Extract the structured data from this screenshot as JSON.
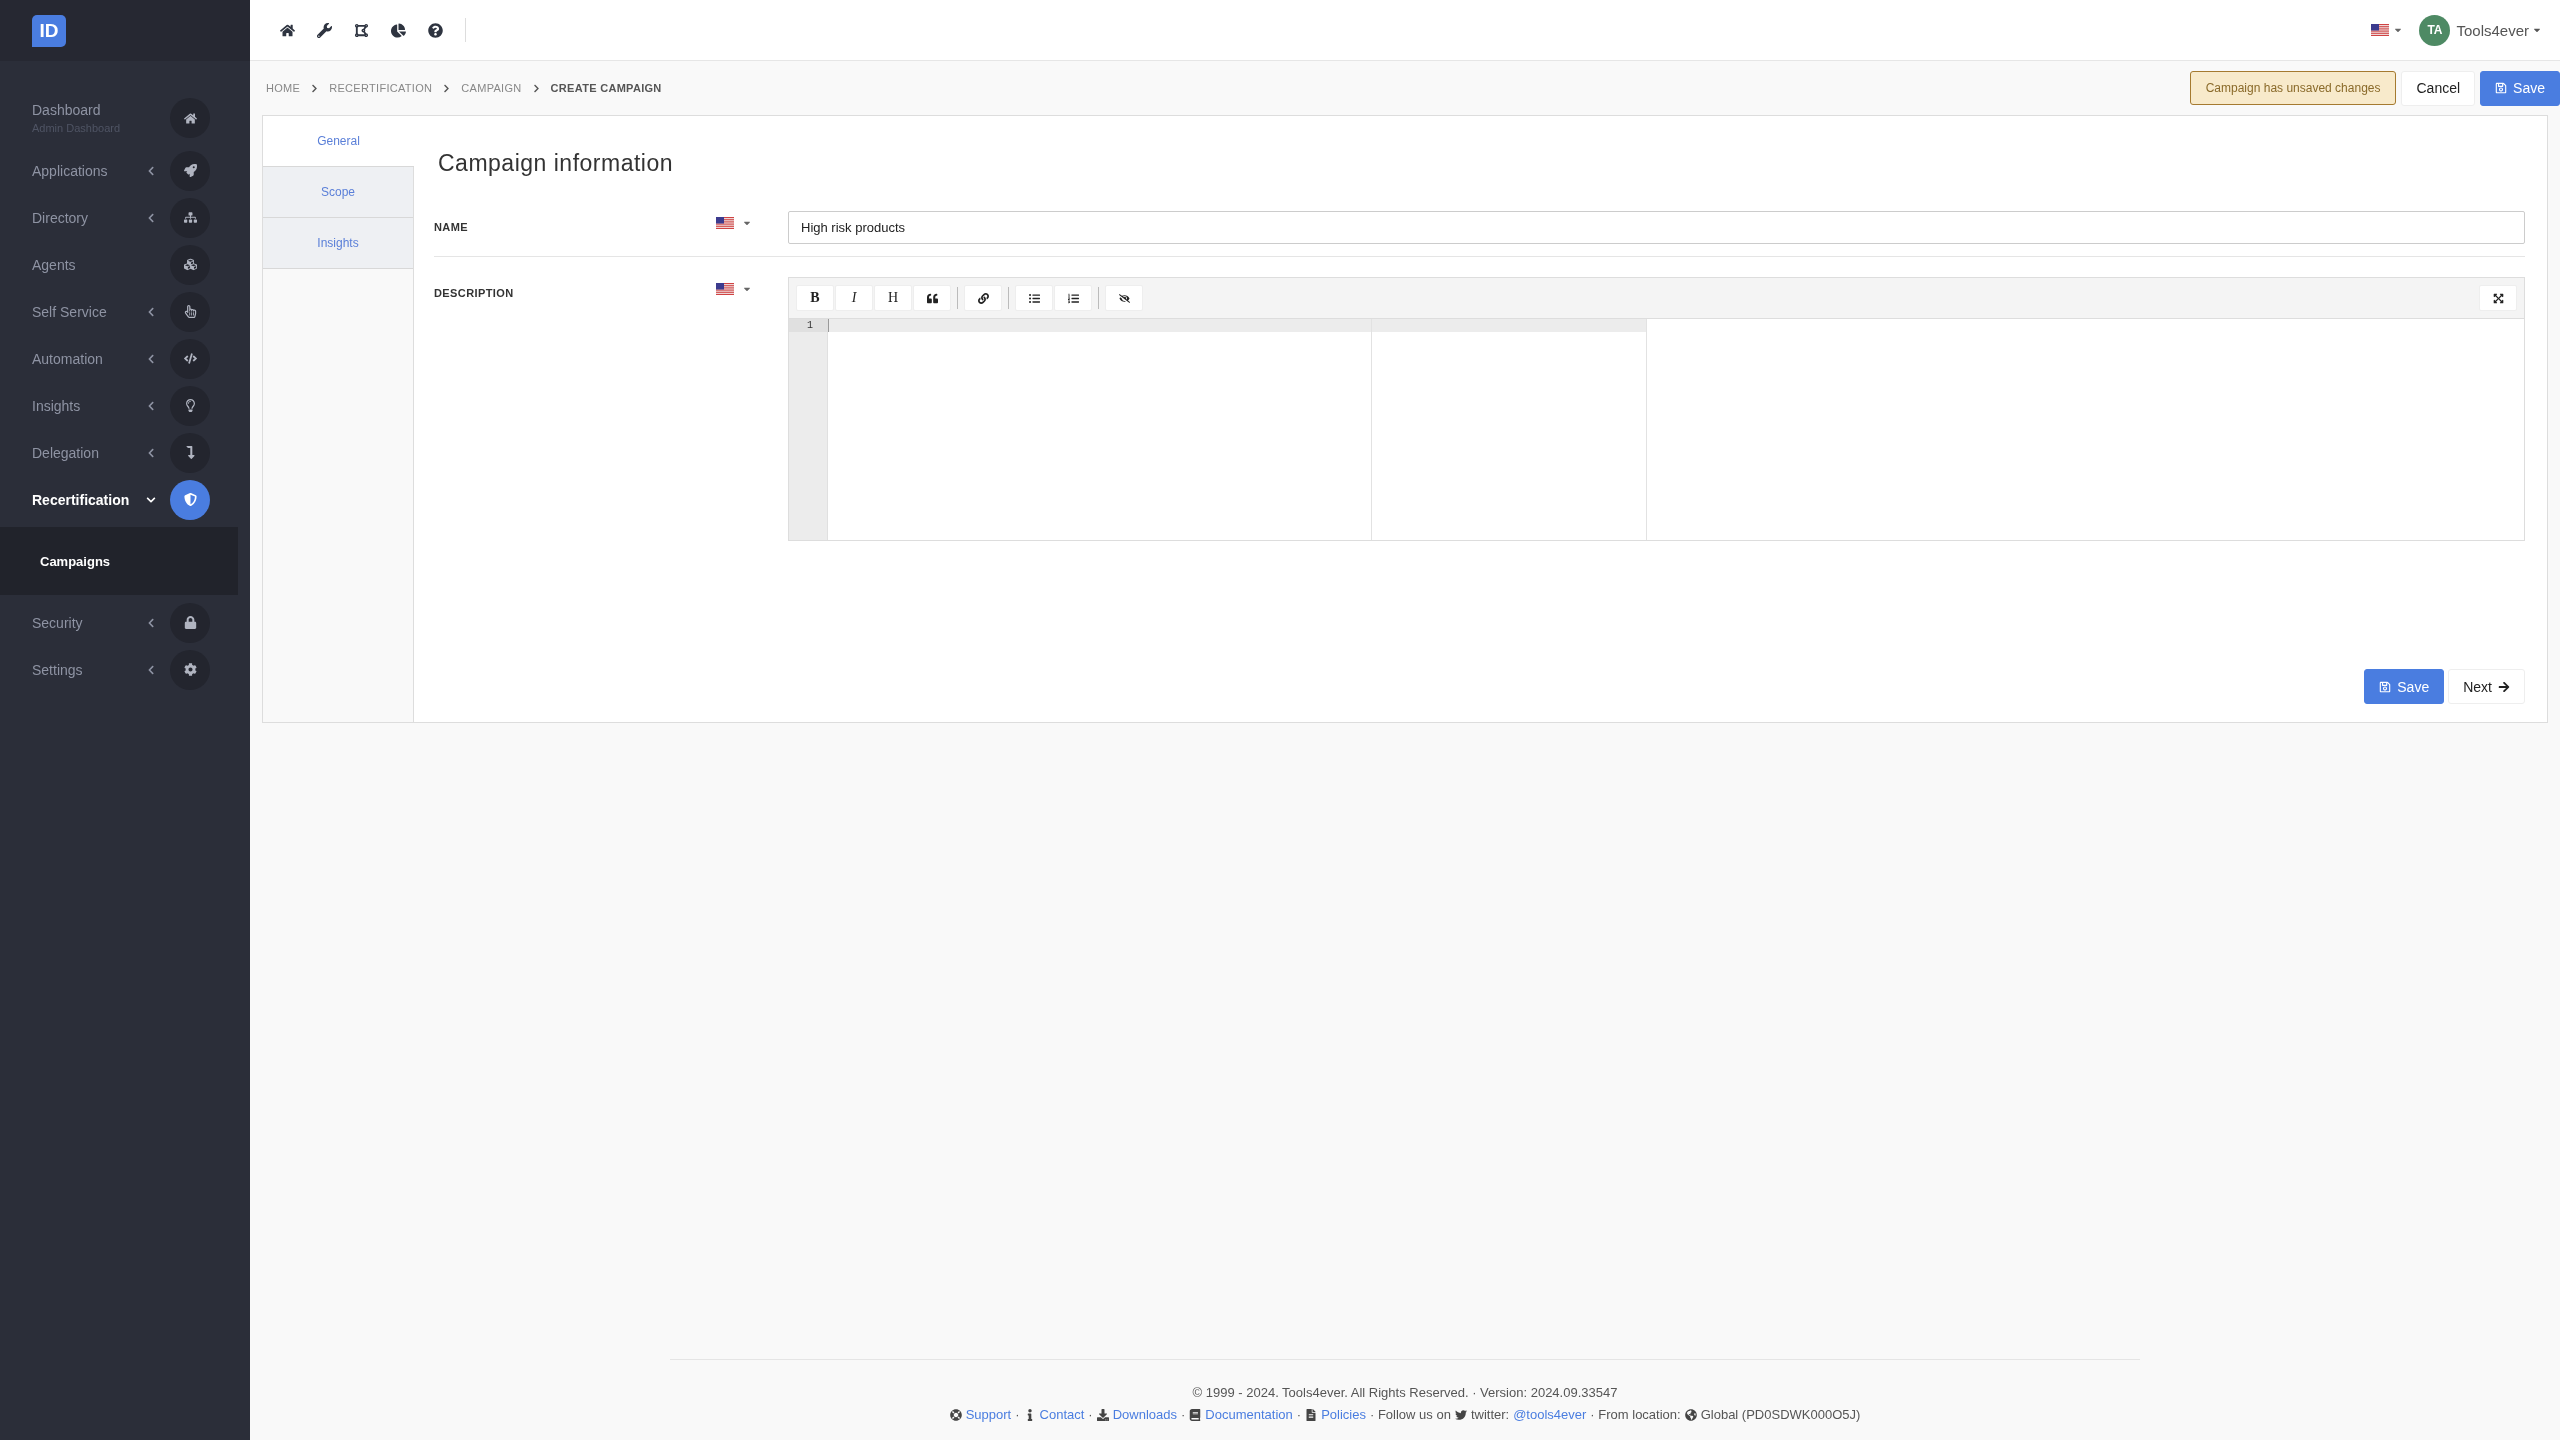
{
  "sidebar": {
    "logo": "ID",
    "items": [
      {
        "label": "Dashboard",
        "sublabel": "Admin Dashboard",
        "selected": false
      },
      {
        "label": "Applications",
        "expanded": false,
        "selected": false
      },
      {
        "label": "Directory",
        "expanded": false,
        "selected": false
      },
      {
        "label": "Agents",
        "selected": false
      },
      {
        "label": "Self Service",
        "expanded": false,
        "selected": false
      },
      {
        "label": "Automation",
        "expanded": false,
        "selected": false
      },
      {
        "label": "Insights",
        "expanded": false,
        "selected": false
      },
      {
        "label": "Delegation",
        "expanded": false,
        "selected": false
      },
      {
        "label": "Recertification",
        "expanded": true,
        "selected": true,
        "children": [
          {
            "label": "Campaigns",
            "selected": true
          }
        ]
      },
      {
        "label": "Security",
        "expanded": false,
        "selected": false
      },
      {
        "label": "Settings",
        "expanded": false,
        "selected": false
      }
    ]
  },
  "topbar": {
    "user": {
      "initials": "TA",
      "name": "Tools4ever"
    }
  },
  "breadcrumb": [
    {
      "label": "HOME",
      "current": false
    },
    {
      "label": "RECERTIFICATION",
      "current": false
    },
    {
      "label": "CAMPAIGN",
      "current": false
    },
    {
      "label": "CREATE CAMPAIGN",
      "current": true
    }
  ],
  "actions": {
    "notice": "Campaign has unsaved changes",
    "cancel": "Cancel",
    "save": "Save"
  },
  "tabs": [
    {
      "label": "General",
      "selected": true
    },
    {
      "label": "Scope",
      "selected": false
    },
    {
      "label": "Insights",
      "selected": false
    }
  ],
  "form": {
    "title": "Campaign information",
    "name": {
      "label": "NAME",
      "value": "High risk products"
    },
    "description": {
      "label": "DESCRIPTION",
      "line_number": "1",
      "toolbar": [
        {
          "kind": "bold",
          "label": "B"
        },
        {
          "kind": "italic",
          "label": "I"
        },
        {
          "kind": "heading",
          "label": "H"
        },
        {
          "kind": "quote"
        },
        {
          "kind": "separator"
        },
        {
          "kind": "link"
        },
        {
          "kind": "separator"
        },
        {
          "kind": "bullets"
        },
        {
          "kind": "numbers"
        },
        {
          "kind": "separator"
        },
        {
          "kind": "preview"
        }
      ]
    },
    "save": "Save",
    "next": "Next"
  },
  "footer": {
    "copyright": "© 1999 - 2024. Tools4ever. All Rights Reserved. · Version: 2024.09.33547",
    "items": [
      {
        "kind": "link",
        "text": "Support"
      },
      {
        "kind": "text",
        "text": "·"
      },
      {
        "kind": "link",
        "text": "Contact"
      },
      {
        "kind": "text",
        "text": "·"
      },
      {
        "kind": "link",
        "text": "Downloads"
      },
      {
        "kind": "text",
        "text": "·"
      },
      {
        "kind": "link",
        "text": "Documentation"
      },
      {
        "kind": "text",
        "text": "·"
      },
      {
        "kind": "link",
        "text": "Policies"
      },
      {
        "kind": "text",
        "text": "· Follow us on"
      },
      {
        "kind": "text",
        "text": "twitter:"
      },
      {
        "kind": "link",
        "text": "@tools4ever"
      },
      {
        "kind": "text",
        "text": "· From location:"
      },
      {
        "kind": "text",
        "text": "Global (PD0SDWK000O5J)"
      }
    ]
  }
}
